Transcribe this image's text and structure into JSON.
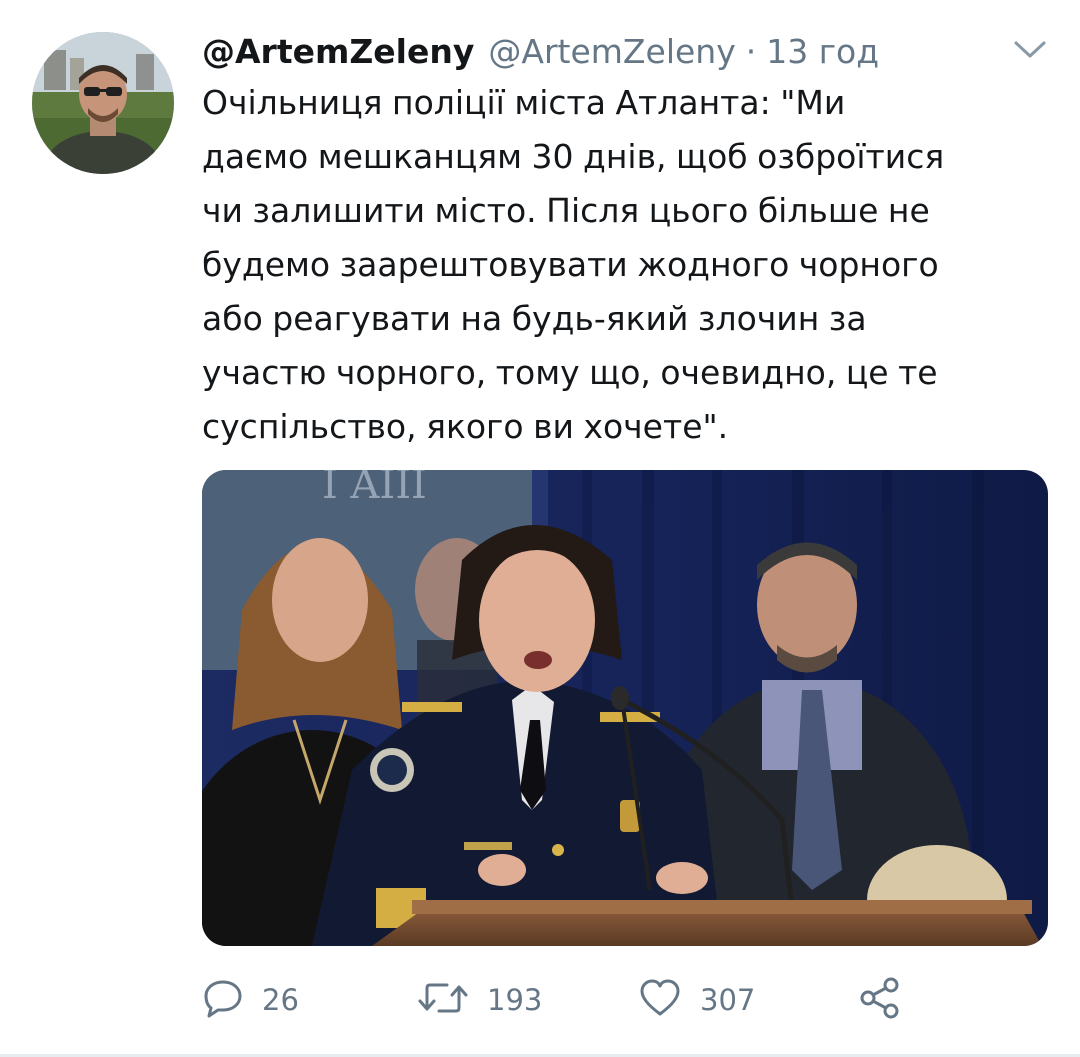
{
  "tweet": {
    "display_name": "@ArtemZeleny",
    "handle": "@ArtemZeleny",
    "separator": "·",
    "time": "13 год",
    "text_lines": [
      "Очільниця поліції міста Атланта: \"Ми",
      "даємо мешканцям 30 днів, щоб озброїтися",
      "чи залишити місто. Після цього більше не",
      "будемо заарештовувати жодного чорного",
      "або реагувати на будь-який злочин за",
      "участю чорного, тому що, очевидно, це те",
      "суспільство, якого ви хочете\"."
    ]
  },
  "actions": {
    "reply_count": "26",
    "retweet_count": "193",
    "like_count": "307"
  },
  "icons": {
    "reply": "reply-icon",
    "retweet": "retweet-icon",
    "like": "heart-icon",
    "share": "share-icon",
    "caret": "chevron-down-icon"
  },
  "colors": {
    "text_primary": "#14171a",
    "text_secondary": "#657786",
    "icon_gray": "#657786",
    "divider": "#e6ecf0"
  }
}
